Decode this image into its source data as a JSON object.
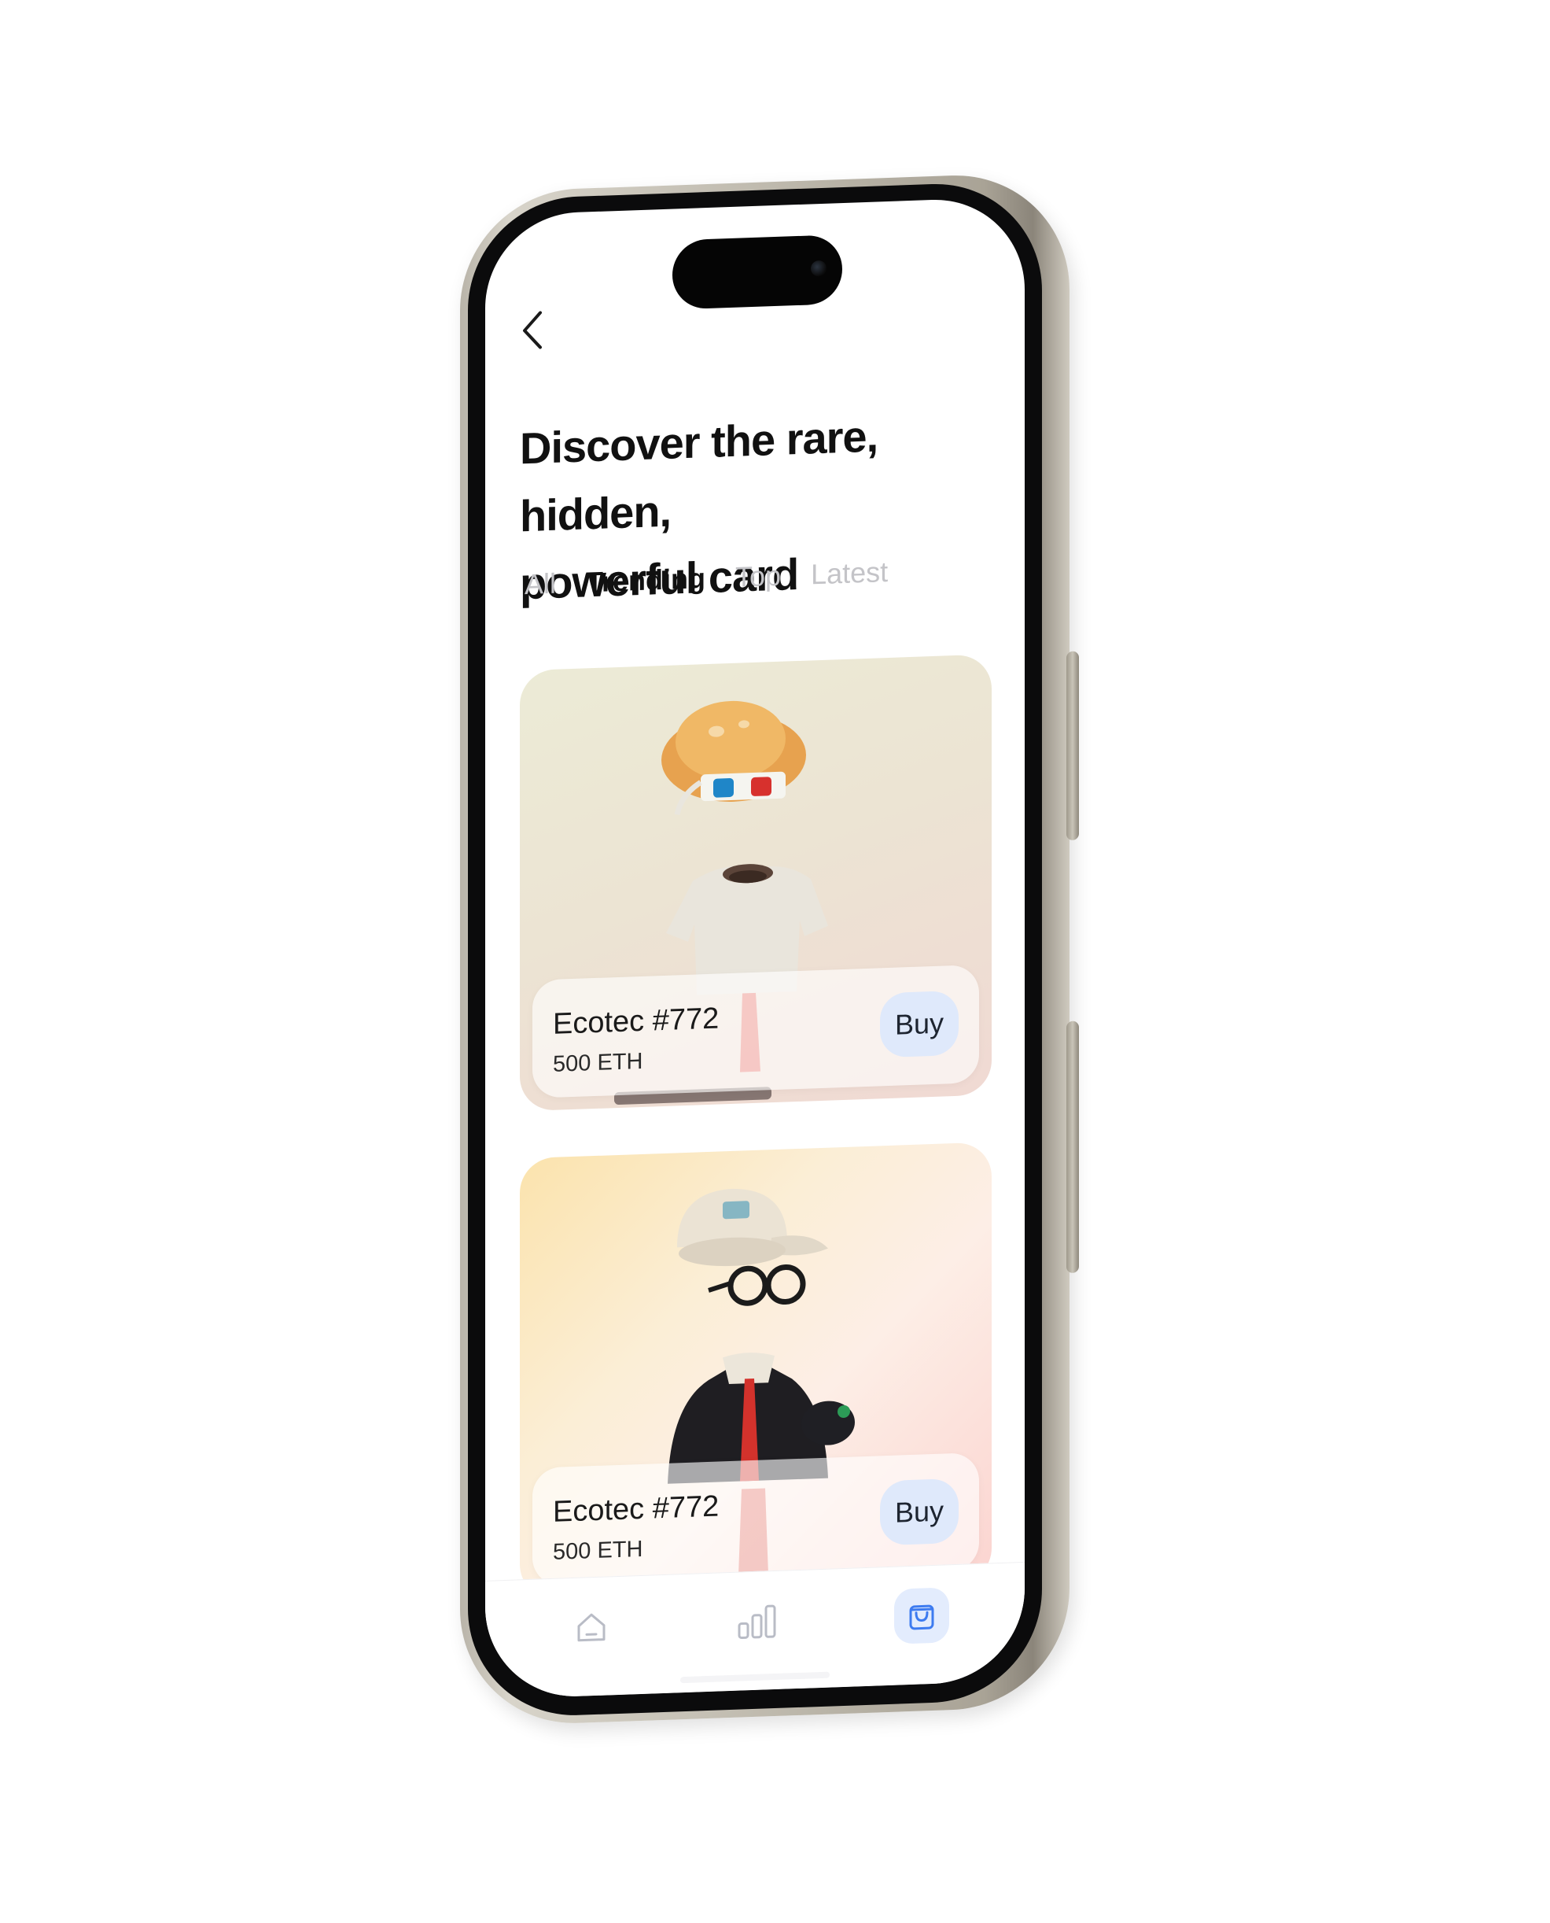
{
  "header": {
    "back_icon": "chevron-left-icon",
    "title_line1": "Discover the rare, hidden,",
    "title_line2": "powerful card"
  },
  "filter_tabs": [
    {
      "label": "All",
      "active": false
    },
    {
      "label": "Trending",
      "active": true
    },
    {
      "label": "Top",
      "active": false
    },
    {
      "label": "Latest",
      "active": false
    }
  ],
  "cards": [
    {
      "name": "Ecotec #772",
      "price": "500 ETH",
      "buy_label": "Buy"
    },
    {
      "name": "Ecotec #772",
      "price": "500 ETH",
      "buy_label": "Buy"
    }
  ],
  "tab_bar": {
    "items": [
      {
        "icon": "home-icon",
        "active": false
      },
      {
        "icon": "bar-chart-icon",
        "active": false
      },
      {
        "icon": "shopping-bag-icon",
        "active": true
      }
    ]
  },
  "colors": {
    "accent": "#dfe9fb",
    "active_tab_text": "#111111",
    "inactive_tab_text": "#c4c4c8",
    "phone_frame": "#bfbaae"
  }
}
